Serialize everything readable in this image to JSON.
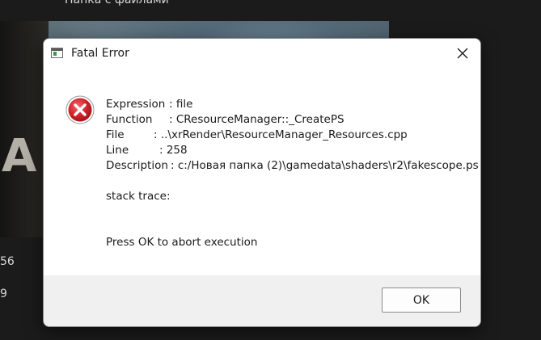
{
  "background": {
    "top_text": "Папка с файлами",
    "poster_letters": "А",
    "left_num_1": "56",
    "left_num_2": "9"
  },
  "dialog": {
    "title": "Fatal Error",
    "icon": "app-window-icon",
    "close_icon": "close-icon",
    "error_icon": "error-icon",
    "expression_label": "Expression",
    "expression_value": ": file",
    "function_label": "Function",
    "function_value": ": CResourceManager::_CreatePS",
    "file_label": "File",
    "file_value": ": ..\\xrRender\\ResourceManager_Resources.cpp",
    "line_label": "Line",
    "line_value": ": 258",
    "description_label": "Description",
    "description_value": ": c:/Новая папка (2)\\gamedata\\shaders\\r2\\fakescope.ps",
    "stack_trace": "stack trace:",
    "prompt": "Press OK to abort execution",
    "ok_label": "OK"
  },
  "colors": {
    "error_red": "#d9282f",
    "footer_bg": "#f0f0f0"
  }
}
